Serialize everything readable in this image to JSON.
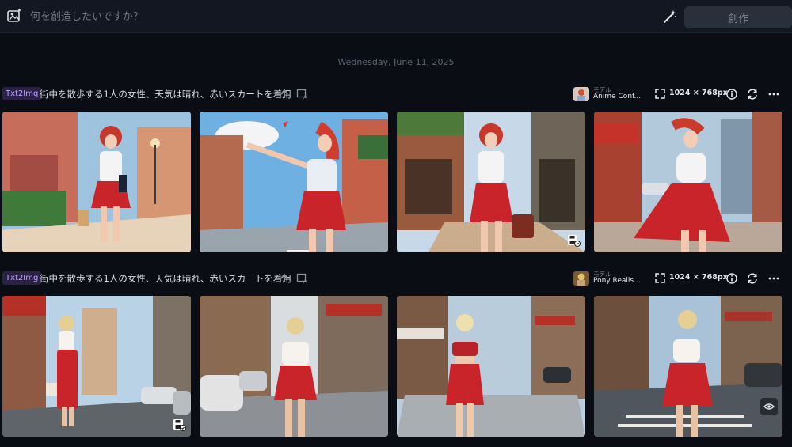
{
  "prompt_bar": {
    "icon": "image-edit-icon",
    "placeholder": "何を創造したいですか？",
    "magic_icon": "magic-wand-icon",
    "create_label": "創作"
  },
  "date_label": "Wednesday, June 11, 2025",
  "tasks": [
    {
      "badge": "Txt2Img",
      "prompt": "街中を散歩する1人の女性、天気は晴れ、赤いスカートを着用",
      "model_label": "モデル",
      "model_name": "Anime Conf...",
      "size": "1024 × 768px",
      "images": [
        {
          "subject": "anime woman red hair white blouse red skirt shopping bag street",
          "action_icon": null
        },
        {
          "subject": "anime woman red hair waving red skirt street sky",
          "action_icon": null
        },
        {
          "subject": "anime woman red hair walking red skirt handbag",
          "action_icon": "save-icon"
        },
        {
          "subject": "anime woman red hair twirling red skirt city",
          "action_icon": null
        }
      ]
    },
    {
      "badge": "Txt2Img",
      "prompt": "街中を散歩する1人の女性、天気は晴れ、赤いスカートを着用",
      "model_label": "モデル",
      "model_name": "Pony Realis...",
      "size": "1024 × 768px",
      "images": [
        {
          "subject": "blonde woman white top long red skirt street cars",
          "action_icon": "save-icon"
        },
        {
          "subject": "blonde woman white top red mini skirt street cars",
          "action_icon": null
        },
        {
          "subject": "blonde woman red top red skirt street",
          "action_icon": null
        },
        {
          "subject": "blonde woman white top red skirt street crosswalk",
          "action_icon": "eye-icon"
        }
      ]
    }
  ],
  "colors": {
    "background": "#0a0d13",
    "topbar": "#121721",
    "badge_bg": "#2b2145",
    "badge_text": "#b9a4ff",
    "skirt_red": "#c8242a"
  }
}
